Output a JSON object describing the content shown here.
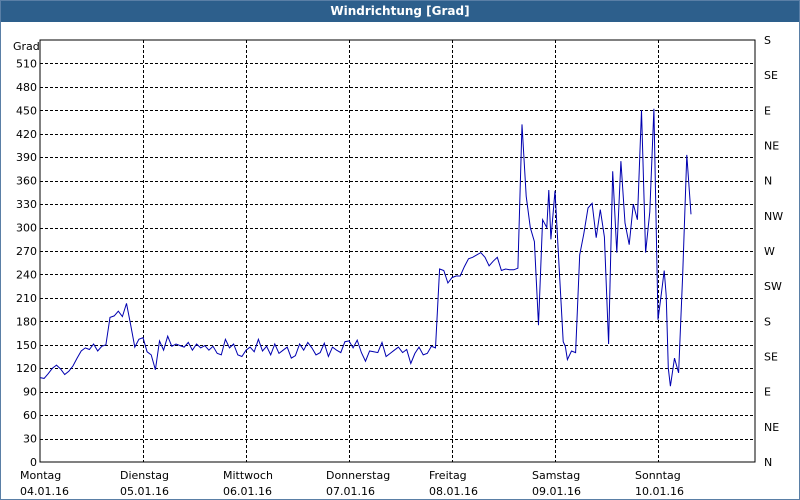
{
  "window": {
    "title": "Windrichtung [Grad]"
  },
  "chart_data": {
    "type": "line",
    "title": "Windrichtung [Grad]",
    "ylabel": "Grad",
    "ylim": [
      0,
      540
    ],
    "yticks": [
      0,
      30,
      60,
      90,
      120,
      150,
      180,
      210,
      240,
      270,
      300,
      330,
      360,
      390,
      420,
      450,
      480,
      510
    ],
    "right_axis_labels": [
      "N",
      "NE",
      "E",
      "SE",
      "S",
      "SW",
      "W",
      "NW",
      "N",
      "NE",
      "E",
      "SE",
      "S"
    ],
    "x_categories": [
      {
        "day": "Montag",
        "date": "04.01.16"
      },
      {
        "day": "Dienstag",
        "date": "05.01.16"
      },
      {
        "day": "Mittwoch",
        "date": "06.01.16"
      },
      {
        "day": "Donnerstag",
        "date": "07.01.16"
      },
      {
        "day": "Freitag",
        "date": "08.01.16"
      },
      {
        "day": "Samstag",
        "date": "09.01.16"
      },
      {
        "day": "Sonntag",
        "date": "10.01.16"
      }
    ],
    "xlim_days": [
      0,
      7
    ],
    "grid": true,
    "series": [
      {
        "color": "#0000b0",
        "x_days": [
          0.0,
          0.04,
          0.08,
          0.12,
          0.16,
          0.2,
          0.24,
          0.28,
          0.32,
          0.36,
          0.4,
          0.44,
          0.48,
          0.52,
          0.56,
          0.6,
          0.64,
          0.68,
          0.72,
          0.76,
          0.8,
          0.84,
          0.88,
          0.92,
          0.96,
          1.0,
          1.04,
          1.08,
          1.12,
          1.16,
          1.2,
          1.24,
          1.28,
          1.32,
          1.36,
          1.4,
          1.44,
          1.48,
          1.52,
          1.56,
          1.6,
          1.64,
          1.68,
          1.72,
          1.76,
          1.8,
          1.84,
          1.88,
          1.92,
          1.96,
          2.0,
          2.04,
          2.08,
          2.12,
          2.16,
          2.2,
          2.24,
          2.28,
          2.32,
          2.36,
          2.4,
          2.44,
          2.48,
          2.52,
          2.56,
          2.6,
          2.64,
          2.68,
          2.72,
          2.76,
          2.8,
          2.84,
          2.88,
          2.92,
          2.96,
          3.0,
          3.04,
          3.08,
          3.12,
          3.16,
          3.2,
          3.24,
          3.28,
          3.32,
          3.36,
          3.4,
          3.44,
          3.48,
          3.52,
          3.56,
          3.6,
          3.64,
          3.68,
          3.72,
          3.76,
          3.8,
          3.84,
          3.88,
          3.92,
          3.96,
          4.0,
          4.04,
          4.08,
          4.12,
          4.16,
          4.2,
          4.24,
          4.28,
          4.32,
          4.36,
          4.4,
          4.44,
          4.48,
          4.52,
          4.56,
          4.6,
          4.64,
          4.68,
          4.72,
          4.76,
          4.8,
          4.84,
          4.88,
          4.92,
          4.94,
          4.96,
          4.98,
          5.0,
          5.04,
          5.08,
          5.1,
          5.12,
          5.16,
          5.2,
          5.24,
          5.28,
          5.32,
          5.36,
          5.4,
          5.44,
          5.48,
          5.52,
          5.56,
          5.6,
          5.64,
          5.68,
          5.72,
          5.76,
          5.8,
          5.84,
          5.88,
          5.92,
          5.96,
          6.0,
          6.04,
          6.06,
          6.08,
          6.1,
          6.12,
          6.16,
          6.2,
          6.24,
          6.28,
          6.32,
          6.36,
          6.4,
          6.42,
          6.44,
          6.48,
          6.52,
          6.56,
          6.6,
          6.64,
          6.68,
          6.72,
          6.76,
          6.8,
          6.84,
          6.86,
          6.88,
          6.92,
          6.96,
          7.0
        ],
        "values": [
          108,
          107,
          113,
          120,
          124,
          119,
          112,
          116,
          123,
          133,
          142,
          146,
          144,
          151,
          142,
          148,
          150,
          185,
          187,
          193,
          186,
          203,
          176,
          147,
          157,
          159,
          141,
          137,
          118,
          155,
          143,
          161,
          148,
          151,
          149,
          147,
          153,
          143,
          151,
          146,
          149,
          143,
          148,
          139,
          137,
          157,
          146,
          151,
          137,
          135,
          143,
          147,
          141,
          157,
          142,
          148,
          137,
          151,
          139,
          143,
          147,
          133,
          136,
          151,
          143,
          153,
          146,
          137,
          140,
          152,
          135,
          147,
          143,
          140,
          154,
          155,
          146,
          156,
          140,
          129,
          142,
          141,
          140,
          153,
          135,
          139,
          143,
          147,
          140,
          144,
          126,
          139,
          147,
          137,
          139,
          148,
          146,
          247,
          245,
          229,
          236,
          238,
          238,
          250,
          260,
          262,
          265,
          268,
          262,
          251,
          257,
          262,
          245,
          247,
          246,
          246,
          248,
          432,
          340,
          300,
          282,
          175,
          310,
          300,
          348,
          285,
          315,
          347,
          250,
          154,
          148,
          131,
          142,
          140,
          265,
          292,
          325,
          331,
          287,
          323,
          288,
          151,
          372,
          268,
          385,
          306,
          278,
          330,
          310,
          450,
          268,
          320,
          452,
          182,
          223,
          245,
          213,
          120,
          97,
          133,
          114,
          240,
          393,
          317
        ]
      }
    ]
  }
}
